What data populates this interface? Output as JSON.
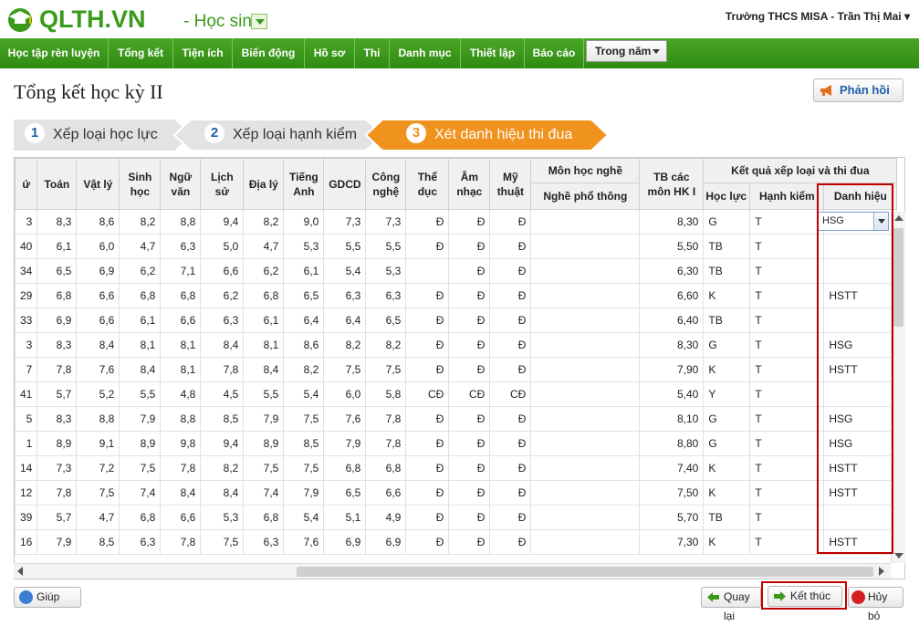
{
  "app": {
    "brand": "QLTH.VN",
    "role": "- Học sinh",
    "user": "Trường THCS MISA - Trần Thị Mai ▾"
  },
  "menu": [
    "Học tập rèn luyện",
    "Tổng kết",
    "Tiện ích",
    "Biến động",
    "Hồ sơ",
    "Thi",
    "Danh mục",
    "Thiết lập",
    "Báo cáo"
  ],
  "year_select": "Trong năm",
  "page": {
    "title": "Tổng kết học kỳ II",
    "feedback": "Phản hồi"
  },
  "steps": [
    {
      "num": "1",
      "label": "Xếp loại học lực"
    },
    {
      "num": "2",
      "label": "Xếp loại hạnh kiểm"
    },
    {
      "num": "3",
      "label": "Xét danh hiệu thi đua"
    }
  ],
  "table": {
    "headers": {
      "stt": "ứ",
      "toan": "Toán",
      "vatly": "Vật lý",
      "sinhhoc": "Sinh học",
      "nguvan": "Ngữ văn",
      "lichsu": "Lịch sử",
      "dialy": "Địa lý",
      "tienganh": "Tiếng Anh",
      "gdcd": "GDCD",
      "congnghe": "Công nghệ",
      "theduc": "Thể dục",
      "amnhac": "Âm nhạc",
      "mythuat": "Mỹ thuật",
      "monnghe": "Môn học nghề",
      "nghept": "Nghề phổ thông",
      "tb": "TB các môn HK I",
      "ketqua": "Kết quả xếp loại và thi đua",
      "hocluc": "Học lực",
      "hanhkiem": "Hạnh kiểm",
      "danhhieu": "Danh hiệu"
    },
    "rows": [
      [
        "3",
        "8,3",
        "8,6",
        "8,2",
        "8,8",
        "9,4",
        "8,2",
        "9,0",
        "7,3",
        "7,3",
        "Đ",
        "Đ",
        "Đ",
        "",
        "8,30",
        "G",
        "T",
        "HSG"
      ],
      [
        "40",
        "6,1",
        "6,0",
        "4,7",
        "6,3",
        "5,0",
        "4,7",
        "5,3",
        "5,5",
        "5,5",
        "Đ",
        "Đ",
        "Đ",
        "",
        "5,50",
        "TB",
        "T",
        ""
      ],
      [
        "34",
        "6,5",
        "6,9",
        "6,2",
        "7,1",
        "6,6",
        "6,2",
        "6,1",
        "5,4",
        "5,3",
        "",
        "Đ",
        "Đ",
        "",
        "6,30",
        "TB",
        "T",
        ""
      ],
      [
        "29",
        "6,8",
        "6,6",
        "6,8",
        "6,8",
        "6,2",
        "6,8",
        "6,5",
        "6,3",
        "6,3",
        "Đ",
        "Đ",
        "Đ",
        "",
        "6,60",
        "K",
        "T",
        "HSTT"
      ],
      [
        "33",
        "6,9",
        "6,6",
        "6,1",
        "6,6",
        "6,3",
        "6,1",
        "6,4",
        "6,4",
        "6,5",
        "Đ",
        "Đ",
        "Đ",
        "",
        "6,40",
        "TB",
        "T",
        ""
      ],
      [
        "3",
        "8,3",
        "8,4",
        "8,1",
        "8,1",
        "8,4",
        "8,1",
        "8,6",
        "8,2",
        "8,2",
        "Đ",
        "Đ",
        "Đ",
        "",
        "8,30",
        "G",
        "T",
        "HSG"
      ],
      [
        "7",
        "7,8",
        "7,6",
        "8,4",
        "8,1",
        "7,8",
        "8,4",
        "8,2",
        "7,5",
        "7,5",
        "Đ",
        "Đ",
        "Đ",
        "",
        "7,90",
        "K",
        "T",
        "HSTT"
      ],
      [
        "41",
        "5,7",
        "5,2",
        "5,5",
        "4,8",
        "4,5",
        "5,5",
        "5,4",
        "6,0",
        "5,8",
        "CĐ",
        "CĐ",
        "CĐ",
        "",
        "5,40",
        "Y",
        "T",
        ""
      ],
      [
        "5",
        "8,3",
        "8,8",
        "7,9",
        "8,8",
        "8,5",
        "7,9",
        "7,5",
        "7,6",
        "7,8",
        "Đ",
        "Đ",
        "Đ",
        "",
        "8,10",
        "G",
        "T",
        "HSG"
      ],
      [
        "1",
        "8,9",
        "9,1",
        "8,9",
        "9,8",
        "9,4",
        "8,9",
        "8,5",
        "7,9",
        "7,8",
        "Đ",
        "Đ",
        "Đ",
        "",
        "8,80",
        "G",
        "T",
        "HSG"
      ],
      [
        "14",
        "7,3",
        "7,2",
        "7,5",
        "7,8",
        "8,2",
        "7,5",
        "7,5",
        "6,8",
        "6,8",
        "Đ",
        "Đ",
        "Đ",
        "",
        "7,40",
        "K",
        "T",
        "HSTT"
      ],
      [
        "12",
        "7,8",
        "7,5",
        "7,4",
        "8,4",
        "8,4",
        "7,4",
        "7,9",
        "6,5",
        "6,6",
        "Đ",
        "Đ",
        "Đ",
        "",
        "7,50",
        "K",
        "T",
        "HSTT"
      ],
      [
        "39",
        "5,7",
        "4,7",
        "6,8",
        "6,6",
        "5,3",
        "6,8",
        "5,4",
        "5,1",
        "4,9",
        "Đ",
        "Đ",
        "Đ",
        "",
        "5,70",
        "TB",
        "T",
        ""
      ],
      [
        "16",
        "7,9",
        "8,5",
        "6,3",
        "7,8",
        "7,5",
        "6,3",
        "7,6",
        "6,9",
        "6,9",
        "Đ",
        "Đ",
        "Đ",
        "",
        "7,30",
        "K",
        "T",
        "HSTT"
      ]
    ],
    "combo_value": "HSG"
  },
  "buttons": {
    "help": "Giúp",
    "back": "Quay lại",
    "finish": "Kết thúc",
    "cancel": "Hủy bỏ"
  },
  "colors": {
    "green": "#2f8c14",
    "orange": "#f0921e",
    "step_gray": "#e0e0e0",
    "highlight": "#c00000"
  }
}
